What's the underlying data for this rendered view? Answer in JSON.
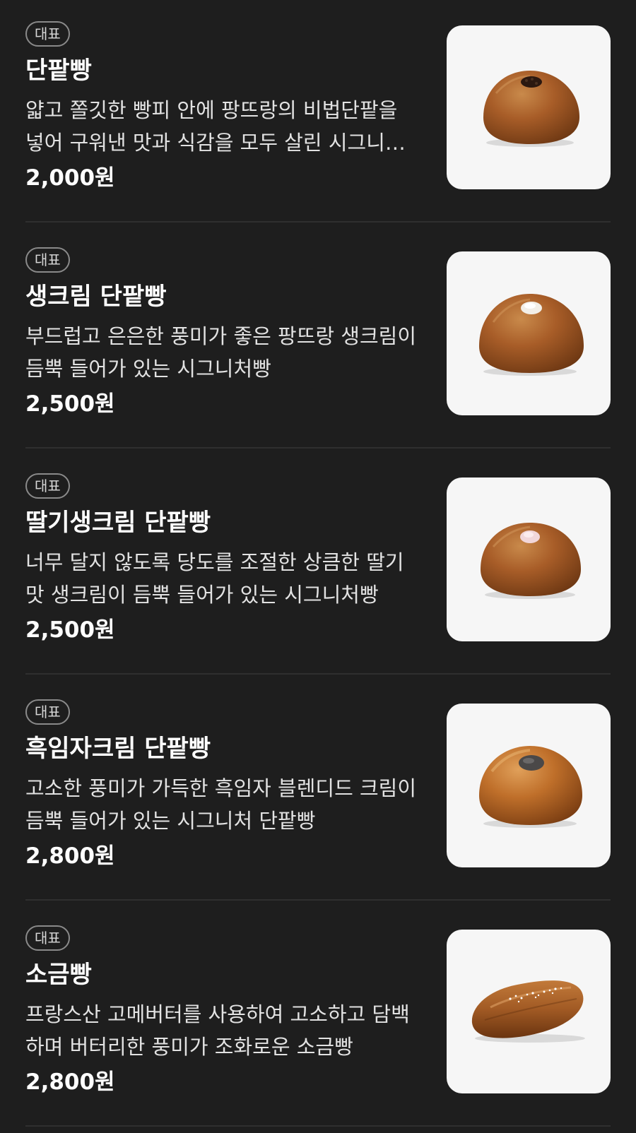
{
  "menu": {
    "items": [
      {
        "badge": "대표",
        "name": "단팥빵",
        "description": "얇고 쫄깃한 빵피 안에 팡뜨랑의 비법단팥을 넣어 구워낸 맛과 식감을 모두 살린 시그니처빵",
        "price": "2,000원",
        "image": "red-bean-bun-image"
      },
      {
        "badge": "대표",
        "name": "생크림 단팥빵",
        "description": "부드럽고 은은한 풍미가 좋은 팡뜨랑 생크림이 듬뿍 들어가 있는 시그니처빵",
        "price": "2,500원",
        "image": "fresh-cream-red-bean-bun-image"
      },
      {
        "badge": "대표",
        "name": "딸기생크림 단팥빵",
        "description": "너무 달지 않도록 당도를 조절한 상큼한 딸기맛 생크림이 듬뿍 들어가 있는 시그니처빵",
        "price": "2,500원",
        "image": "strawberry-cream-red-bean-bun-image"
      },
      {
        "badge": "대표",
        "name": "흑임자크림 단팥빵",
        "description": "고소한 풍미가 가득한 흑임자 블렌디드 크림이 듬뿍 들어가 있는 시그니처 단팥빵",
        "price": "2,800원",
        "image": "black-sesame-cream-red-bean-bun-image"
      },
      {
        "badge": "대표",
        "name": "소금빵",
        "description": "프랑스산 고메버터를 사용하여 고소하고 담백하며 버터리한 풍미가 조화로운 소금빵",
        "price": "2,800원",
        "image": "salt-bread-image"
      }
    ]
  },
  "colors": {
    "background": "#1e1e1e",
    "text": "#ffffff",
    "description": "#e2e2e2",
    "badge_border": "#8a8a8a",
    "divider": "#2f2f2f",
    "thumbnail_bg": "#f6f6f6"
  }
}
